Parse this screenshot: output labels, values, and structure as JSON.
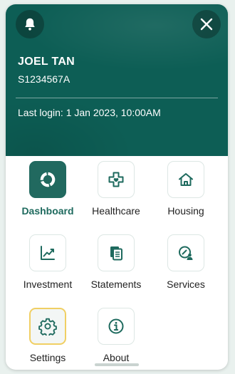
{
  "header": {
    "name": "JOEL TAN",
    "id_number": "S1234567A",
    "last_login": "Last login: 1 Jan 2023, 10:00AM"
  },
  "colors": {
    "header_bg": "#0d5e55",
    "accent": "#1e6a5e",
    "selected_border": "#f0cf63"
  },
  "menu": {
    "items": [
      {
        "label": "Dashboard",
        "icon": "dashboard-ring-icon",
        "state": "active"
      },
      {
        "label": "Healthcare",
        "icon": "healthcare-icon",
        "state": "normal"
      },
      {
        "label": "Housing",
        "icon": "house-icon",
        "state": "normal"
      },
      {
        "label": "Investment",
        "icon": "investment-chart-icon",
        "state": "normal"
      },
      {
        "label": "Statements",
        "icon": "statements-icon",
        "state": "normal"
      },
      {
        "label": "Services",
        "icon": "services-icon",
        "state": "normal"
      },
      {
        "label": "Settings",
        "icon": "gear-icon",
        "state": "selected"
      },
      {
        "label": "About",
        "icon": "info-icon",
        "state": "normal"
      }
    ]
  }
}
